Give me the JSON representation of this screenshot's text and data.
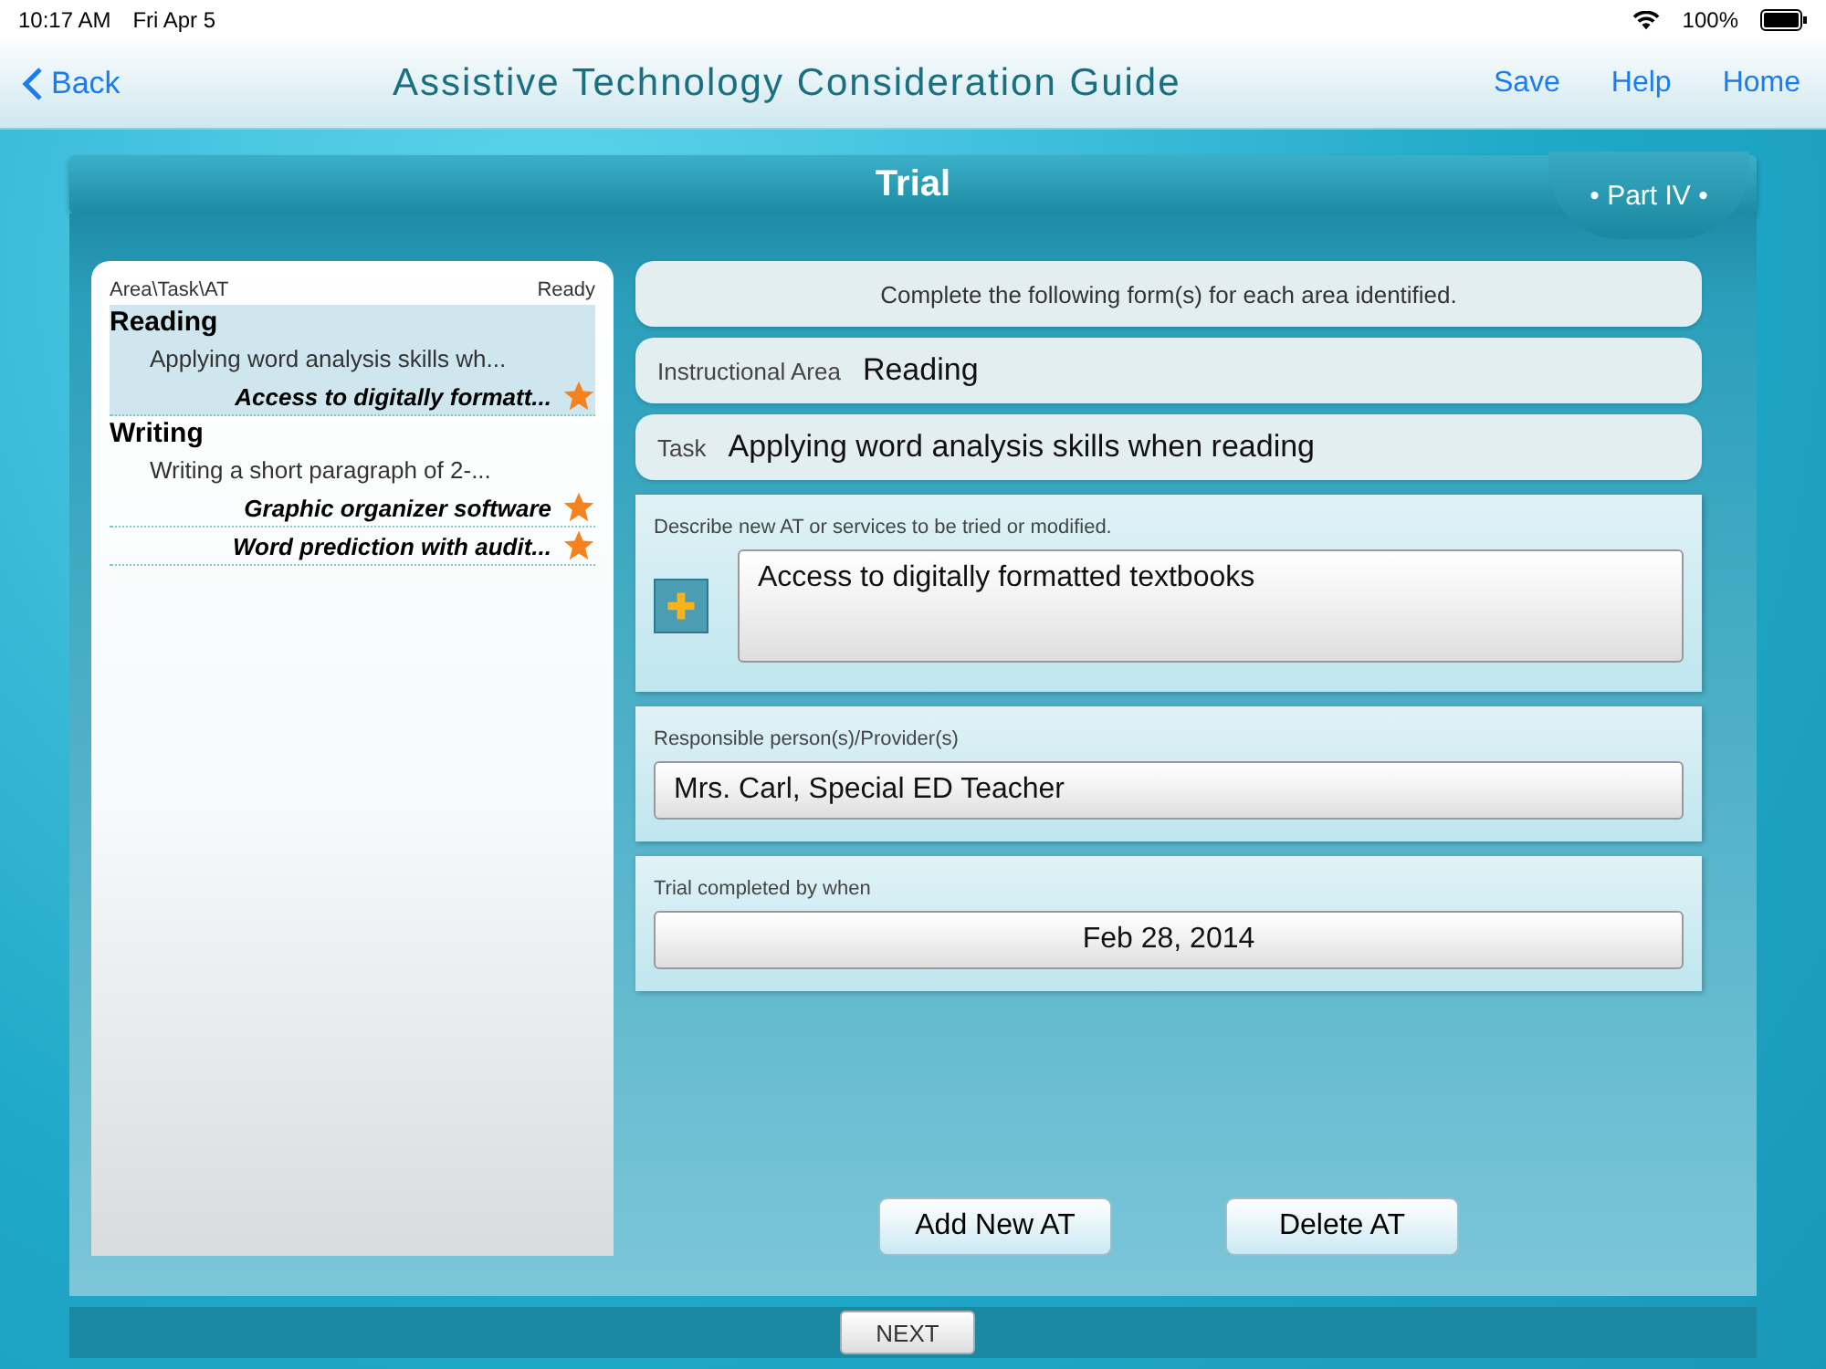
{
  "status_bar": {
    "time": "10:17 AM",
    "date": "Fri Apr 5",
    "battery": "100%"
  },
  "nav": {
    "back": "Back",
    "title": "Assistive Technology Consideration Guide",
    "actions": [
      "Save",
      "Help",
      "Home"
    ]
  },
  "header": {
    "title": "Trial",
    "part": "• Part IV •"
  },
  "list": {
    "column_1": "Area\\Task\\AT",
    "column_2": "Ready",
    "areas": [
      {
        "name": "Reading",
        "selected": true,
        "children": [
          {
            "name": "Applying word analysis skills wh...",
            "children": [
              {
                "name": "Access to digitally formatt...",
                "ready": true
              }
            ]
          }
        ]
      },
      {
        "name": "Writing",
        "selected": false,
        "children": [
          {
            "name": "Writing a short paragraph of 2-...",
            "children": [
              {
                "name": "Graphic organizer software",
                "ready": true
              },
              {
                "name": "Word prediction with audit...",
                "ready": true
              }
            ]
          }
        ]
      }
    ]
  },
  "form": {
    "instruction": "Complete the following form(s) for each area identified.",
    "area_label": "Instructional Area",
    "area_value": "Reading",
    "task_label": "Task",
    "task_value": "Applying word analysis skills when reading",
    "describe_label": "Describe new AT or services to be tried or modified.",
    "describe_value": "Access to digitally formatted textbooks",
    "provider_label": "Responsible person(s)/Provider(s)",
    "provider_value": "Mrs. Carl, Special ED Teacher",
    "date_label": "Trial completed by when",
    "date_value": "Feb 28, 2014"
  },
  "buttons": [
    "Add New AT",
    "Delete AT"
  ],
  "next": "NEXT"
}
